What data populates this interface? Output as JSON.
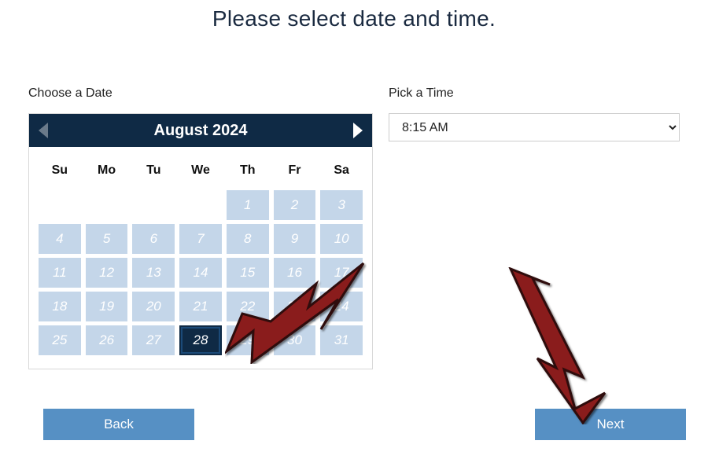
{
  "page": {
    "title": "Please select date and time."
  },
  "date": {
    "label": "Choose a Date",
    "month_title": "August 2024",
    "dow": [
      "Su",
      "Mo",
      "Tu",
      "We",
      "Th",
      "Fr",
      "Sa"
    ],
    "selected": 28
  },
  "time": {
    "label": "Pick a Time",
    "value": "8:15 AM"
  },
  "buttons": {
    "back": "Back",
    "next": "Next"
  }
}
